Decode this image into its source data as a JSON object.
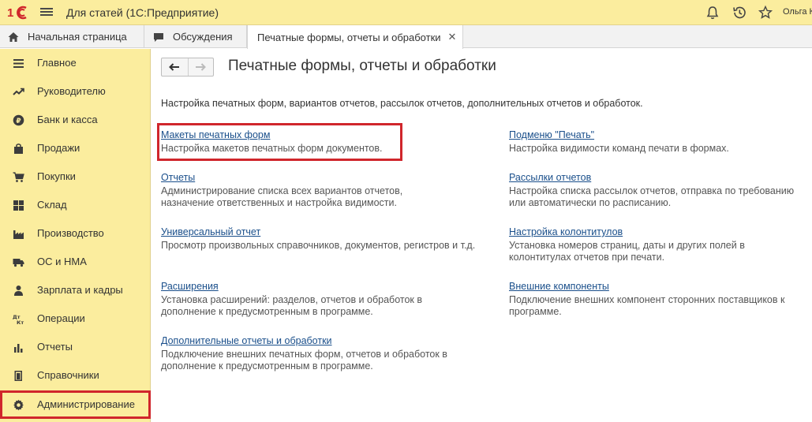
{
  "window": {
    "title": "Для статей  (1С:Предприятие)",
    "user": "Ольга К"
  },
  "tabs": [
    {
      "label": "Начальная страница",
      "icon": "home-icon"
    },
    {
      "label": "Обсуждения",
      "icon": "chat-icon"
    },
    {
      "label": "Печатные формы, отчеты и обработки",
      "icon": "",
      "active": true
    }
  ],
  "sidebar": {
    "items": [
      {
        "label": "Главное",
        "icon": "menu-lines-icon"
      },
      {
        "label": "Руководителю",
        "icon": "trend-icon"
      },
      {
        "label": "Банк и касса",
        "icon": "ruble-coin-icon"
      },
      {
        "label": "Продажи",
        "icon": "shopping-bag-icon"
      },
      {
        "label": "Покупки",
        "icon": "cart-icon"
      },
      {
        "label": "Склад",
        "icon": "warehouse-grid-icon"
      },
      {
        "label": "Производство",
        "icon": "factory-icon"
      },
      {
        "label": "ОС и НМА",
        "icon": "truck-icon"
      },
      {
        "label": "Зарплата и кадры",
        "icon": "person-icon"
      },
      {
        "label": "Операции",
        "icon": "dt-kt-icon"
      },
      {
        "label": "Отчеты",
        "icon": "bar-chart-icon"
      },
      {
        "label": "Справочники",
        "icon": "book-icon"
      },
      {
        "label": "Администрирование",
        "icon": "gear-icon",
        "highlighted": true
      }
    ]
  },
  "main": {
    "title": "Печатные формы, отчеты и обработки",
    "intro": "Настройка печатных форм, вариантов отчетов, рассылок отчетов, дополнительных отчетов и обработок.",
    "left": [
      {
        "link": "Макеты печатных форм",
        "desc": [
          "Настройка макетов печатных форм документов."
        ],
        "highlighted": true
      },
      {
        "link": "Отчеты",
        "desc": [
          "Администрирование списка всех вариантов отчетов,",
          "назначение ответственных и настройка видимости."
        ]
      },
      {
        "link": "Универсальный отчет",
        "desc": [
          "Просмотр произвольных справочников, документов, регистров и т.д."
        ]
      },
      {
        "link": "Расширения",
        "desc": [
          "Установка расширений: разделов, отчетов и обработок в",
          "дополнение к предусмотренным в программе."
        ]
      },
      {
        "link": "Дополнительные отчеты и обработки",
        "desc": [
          "Подключение внешних печатных форм, отчетов и обработок в",
          "дополнение к предусмотренным в программе."
        ]
      }
    ],
    "right": [
      {
        "link": "Подменю \"Печать\"",
        "desc": [
          "Настройка видимости команд печати в формах."
        ]
      },
      {
        "link": "Рассылки отчетов",
        "desc": [
          "Настройка списка рассылок отчетов, отправка по требованию",
          "или автоматически по расписанию."
        ]
      },
      {
        "link": "Настройка колонтитулов",
        "desc": [
          "Установка номеров страниц, даты и других полей в",
          "колонтитулах отчетов при печати."
        ]
      },
      {
        "link": "Внешние компоненты",
        "desc": [
          "Подключение внешних компонент сторонних поставщиков к",
          "программе."
        ]
      }
    ]
  },
  "colors": {
    "sidebar_bg": "#fbed9e",
    "link": "#1a4f8b",
    "highlight_border": "#d0262c"
  }
}
